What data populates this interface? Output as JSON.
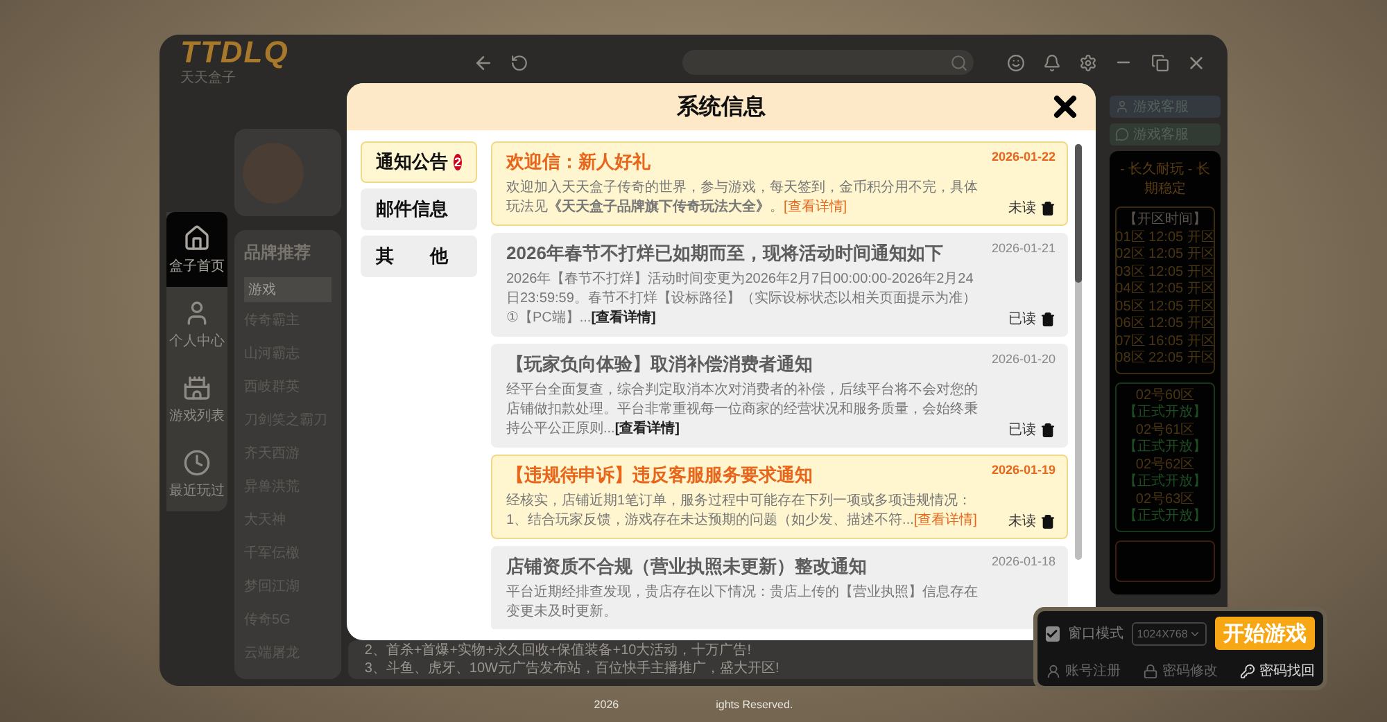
{
  "app": {
    "logo": {
      "mark": "TTDLQ",
      "subtitle": "天天盒子"
    },
    "nav": [
      {
        "label": "盒子首页",
        "selected": true,
        "kind": "home"
      },
      {
        "label": "个人中心",
        "selected": false,
        "kind": "person"
      },
      {
        "label": "游戏列表",
        "selected": false,
        "kind": "castle"
      },
      {
        "label": "最近玩过",
        "selected": false,
        "kind": "clock"
      }
    ],
    "brand": {
      "title": "品牌推荐",
      "column": "游戏",
      "games": [
        "传奇霸主",
        "山河霸志",
        "西岐群英",
        "刀剑笑之霸刀",
        "齐天西游",
        "异兽洪荒",
        "大天神",
        "千军伝檄",
        "梦回江湖",
        "传奇5G",
        "云端屠龙"
      ]
    },
    "promo_lines": [
      "2、首杀+首爆+实物+永久回收+保值装备+10大活动，十万广告!",
      "3、斗鱼、虎牙、10W元广告发布站，百位快手主播推广，盛大开区!"
    ],
    "service_tags": [
      {
        "label": "游戏客服",
        "kind": "qq"
      },
      {
        "label": "游戏客服",
        "kind": "wechat"
      }
    ],
    "server_panel": {
      "headline": "- 长久耐玩 - 长期稳定",
      "schedule_title": "【开区时间】",
      "schedule": [
        "01区 12:05 开区",
        "02区 12:05 开区",
        "03区 12:05 开区",
        "04区 12:05 开区",
        "05区 12:05 开区",
        "06区 12:05 开区",
        "07区 16:05 开区",
        "08区 22:05 开区"
      ],
      "zones": [
        {
          "name": "02号60区",
          "status": "【正式开放】"
        },
        {
          "name": "02号61区",
          "status": "【正式开放】"
        },
        {
          "name": "02号62区",
          "status": "【正式开放】"
        },
        {
          "name": "02号63区",
          "status": "【正式开放】"
        }
      ]
    }
  },
  "dialog": {
    "title": "系统信息",
    "tabs": [
      {
        "label": "通知公告",
        "selected": true,
        "badge": "2"
      },
      {
        "label": "邮件信息",
        "selected": false
      },
      {
        "label": "其　　他",
        "selected": false
      }
    ],
    "messages": [
      {
        "title": "欢迎信：新人好礼",
        "date": "2026-01-22",
        "body": "欢迎加入天天盒子传奇的世界，参与游戏，每天签到，金币积分用不完，具体玩法见**《天天盒子品牌旗下传奇玩法大全》**。",
        "link": "[查看详情]",
        "status": "未读",
        "read": false
      },
      {
        "title": "2026年春节不打烊已如期而至，现将活动时间通知如下",
        "date": "2026-01-21",
        "body": "2026年【春节不打烊】活动时间变更为2026年2月7日00:00:00-2026年2月24日23:59:59。春节不打烊【设标路径】（实际设标状态以相关页面提示为准）①【PC端】...",
        "link": "[查看详情]",
        "status": "已读",
        "read": true
      },
      {
        "title": "【玩家负向体验】取消补偿消费者通知",
        "date": "2026-01-20",
        "body": "经平台全面复查，综合判定取消本次对消费者的补偿，后续平台将不会对您的店铺做扣款处理。平台非常重视每一位商家的经营状况和服务质量，会始终秉持公平公正原则...",
        "link": "[查看详情]",
        "status": "已读",
        "read": true
      },
      {
        "title": "【违规待申诉】违反客服服务要求通知",
        "date": "2026-01-19",
        "body": "经核实，店铺近期1笔订单，服务过程中可能存在下列一项或多项违规情况：1、结合玩家反馈，游戏存在未达预期的问题（如少发、描述不符...",
        "link": "[查看详情]",
        "status": "未读",
        "read": false
      },
      {
        "title": "店铺资质不合规（营业执照未更新）整改通知",
        "date": "2026-01-18",
        "body": "平台近期经排查发现，贵店存在以下情况：贵店上传的【营业执照】信息存在变更未及时更新。",
        "read": true
      }
    ]
  },
  "launcher": {
    "window_mode": {
      "label": "窗口模式",
      "checked": true
    },
    "resolution": "1024X768",
    "start": "开始游戏",
    "links": [
      {
        "label": "账号注册",
        "kind": "user"
      },
      {
        "label": "密码修改",
        "kind": "lock"
      },
      {
        "label": "密码找回",
        "kind": "key"
      }
    ]
  },
  "footer": {
    "year": "2026",
    "rights": "ights Reserved."
  }
}
